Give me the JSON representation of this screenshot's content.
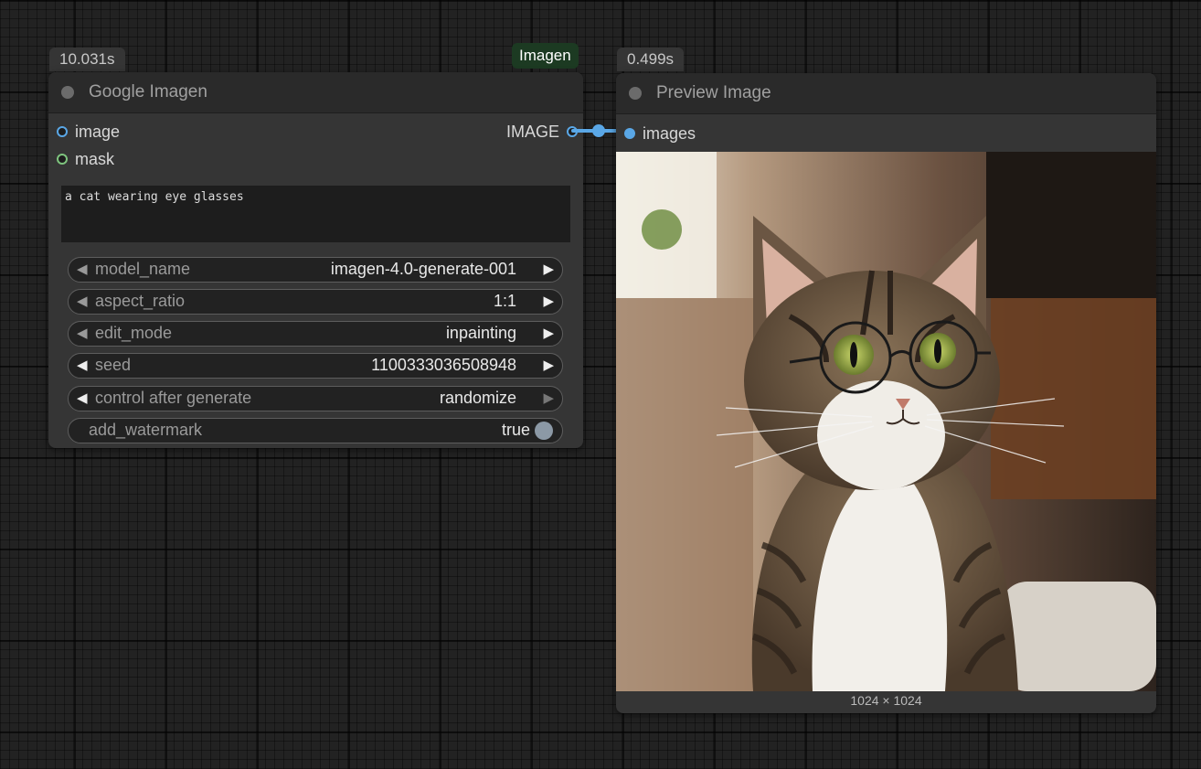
{
  "group": {
    "label": "Imagen"
  },
  "node1": {
    "time": "10.031s",
    "title": "Google Imagen",
    "inputs": [
      "image",
      "mask"
    ],
    "output": "IMAGE",
    "prompt": "a cat wearing eye glasses",
    "widgets": {
      "model_name": {
        "label": "model_name",
        "value": "imagen-4.0-generate-001"
      },
      "aspect_ratio": {
        "label": "aspect_ratio",
        "value": "1:1"
      },
      "edit_mode": {
        "label": "edit_mode",
        "value": "inpainting"
      },
      "seed": {
        "label": "seed",
        "value": "1100333036508948"
      },
      "control_after_generate": {
        "label": "control after generate",
        "value": "randomize"
      },
      "add_watermark": {
        "label": "add_watermark",
        "value": "true"
      }
    }
  },
  "node2": {
    "time": "0.499s",
    "title": "Preview Image",
    "input": "images",
    "dimensions": "1024 × 1024"
  },
  "colors": {
    "link": "#5aa7e6",
    "image_slot": "#5aa7e6",
    "mask_slot": "#7ec47e",
    "group": "#1c3a22"
  }
}
